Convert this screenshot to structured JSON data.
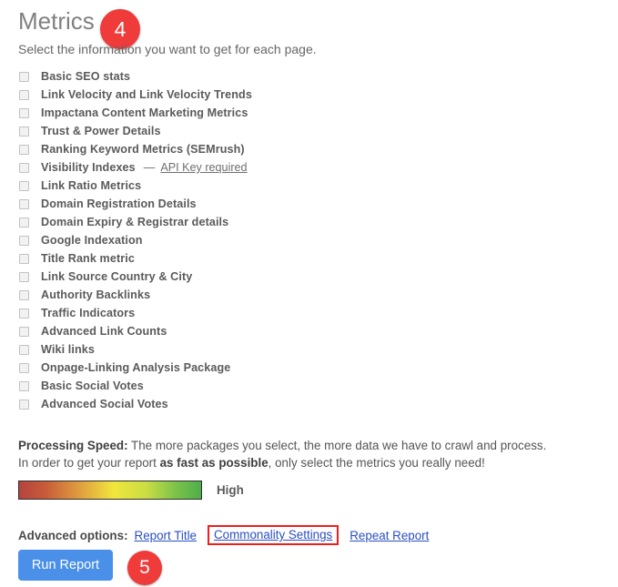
{
  "header": {
    "title": "Metrics",
    "step_badge": "4",
    "subtitle": "Select the information you want to get for each page."
  },
  "metrics": {
    "items": [
      {
        "label": "Basic SEO stats",
        "checked": false
      },
      {
        "label": "Link Velocity and Link Velocity Trends",
        "checked": false
      },
      {
        "label": "Impactana Content Marketing Metrics",
        "checked": false
      },
      {
        "label": "Trust & Power Details",
        "checked": false
      },
      {
        "label": "Ranking Keyword Metrics (SEMrush)",
        "checked": false
      },
      {
        "label": "Visibility Indexes",
        "checked": false,
        "dash": "—",
        "note_link": "API Key required"
      },
      {
        "label": "Link Ratio Metrics",
        "checked": false
      },
      {
        "label": "Domain Registration Details",
        "checked": false
      },
      {
        "label": "Domain Expiry & Registrar details",
        "checked": false
      },
      {
        "label": "Google Indexation",
        "checked": false
      },
      {
        "label": "Title Rank metric",
        "checked": false
      },
      {
        "label": "Link Source Country & City",
        "checked": false
      },
      {
        "label": "Authority Backlinks",
        "checked": false
      },
      {
        "label": "Traffic Indicators",
        "checked": false
      },
      {
        "label": "Advanced Link Counts",
        "checked": false
      },
      {
        "label": "Wiki links",
        "checked": false
      },
      {
        "label": "Onpage-Linking Analysis Package",
        "checked": false
      },
      {
        "label": "Basic Social Votes",
        "checked": false
      },
      {
        "label": "Advanced Social Votes",
        "checked": false
      }
    ]
  },
  "processing_speed": {
    "label": "Processing Speed:",
    "line1_rest": " The more packages you select, the more data we have to crawl and process.",
    "line2_start": "In order to get your report ",
    "line2_bold": "as fast as possible",
    "line2_end": ", only select the metrics you really need!",
    "gradient_label": "High",
    "gradient_colors": {
      "start": "#b4443d",
      "middle": "#f1e63c",
      "end": "#4fae4b"
    }
  },
  "advanced_options": {
    "label": "Advanced options:",
    "links": [
      {
        "text": "Report Title",
        "highlighted": false
      },
      {
        "text": "Commonality Settings",
        "highlighted": true
      },
      {
        "text": "Repeat Report",
        "highlighted": false
      }
    ],
    "highlight_color": "#f11d1d",
    "link_color": "#2a4fc4"
  },
  "footer": {
    "run_button": "Run Report",
    "step_badge": "5",
    "button_color": "#4a90e8",
    "badge_color": "#ef3b39"
  }
}
